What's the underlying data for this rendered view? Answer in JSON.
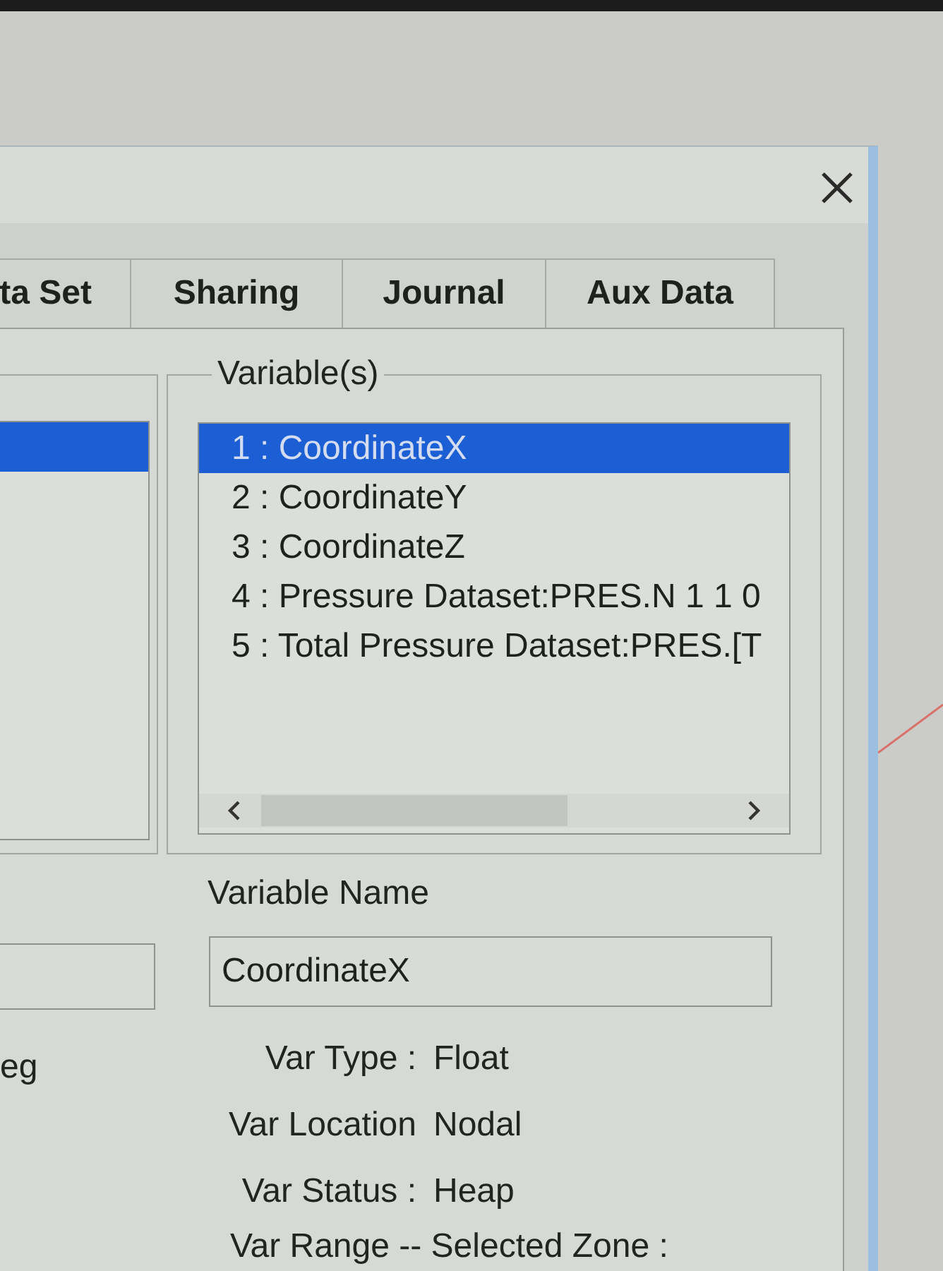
{
  "tabs": [
    {
      "label": "ta Set",
      "selected": false
    },
    {
      "label": "Sharing",
      "selected": false
    },
    {
      "label": "Journal",
      "selected": false
    },
    {
      "label": "Aux Data",
      "selected": false
    }
  ],
  "left_group": {
    "list": {
      "items": [
        {
          "selected": true
        }
      ]
    },
    "label": "eg"
  },
  "variables": {
    "title": "Variable(s)",
    "items": [
      {
        "label": "1 : CoordinateX",
        "selected": true
      },
      {
        "label": "2 : CoordinateY",
        "selected": false
      },
      {
        "label": "3 : CoordinateZ",
        "selected": false
      },
      {
        "label": "4 : Pressure Dataset:PRES.N 1 1 0",
        "selected": false
      },
      {
        "label": "5 : Total Pressure Dataset:PRES.[T",
        "selected": false
      }
    ]
  },
  "variable_name": {
    "label": "Variable Name",
    "value": "CoordinateX"
  },
  "properties": [
    {
      "kind": "pair",
      "label": "Var Type :",
      "value": "Float"
    },
    {
      "kind": "pair",
      "label": "Var Location",
      "value": "Nodal"
    },
    {
      "kind": "pair",
      "label": "Var Status :",
      "value": "Heap"
    },
    {
      "kind": "heading",
      "label": "Var Range -- Selected Zone :"
    }
  ]
}
